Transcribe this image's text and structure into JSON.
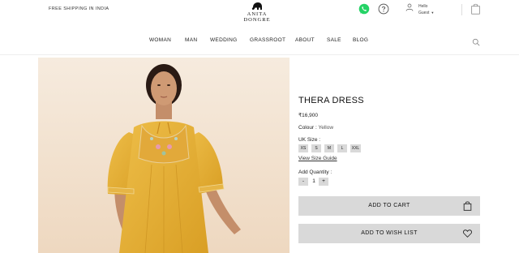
{
  "topbar": {
    "shipping_text": "FREE SHIPPING IN INDIA",
    "brand_name": "ANITA DONGRE",
    "user_greeting": "Hello",
    "user_name": "Guest"
  },
  "icons": {
    "brand_logo": "elephant-logo",
    "whatsapp": "whatsapp-icon",
    "help": "help-icon",
    "user": "user-icon",
    "bag": "shopping-bag-icon",
    "search": "search-icon",
    "wishlist": "heart-icon"
  },
  "nav": {
    "items": [
      {
        "label": "WOMAN"
      },
      {
        "label": "MAN"
      },
      {
        "label": "WEDDING"
      },
      {
        "label": "GRASSROOT"
      },
      {
        "label": "ABOUT"
      },
      {
        "label": "SALE"
      },
      {
        "label": "BLOG"
      }
    ]
  },
  "product": {
    "title": "THERA DRESS",
    "price": "₹16,900",
    "colour_label": "Colour",
    "colour_value": "Yellow",
    "size_label": "UK Size :",
    "sizes": [
      "XS",
      "S",
      "M",
      "L",
      "XXL"
    ],
    "size_guide": "View Size Guide",
    "quantity_label": "Add Quantity :",
    "quantity_minus": "-",
    "quantity_value": "1",
    "quantity_plus": "+",
    "add_to_cart": "ADD TO CART",
    "add_to_wishlist": "ADD TO WISH LIST"
  },
  "colors": {
    "whatsapp_green": "#25d366",
    "button_grey": "#d9d9d9",
    "dress_yellow": "#e8b23a",
    "photo_background": "#f4e6d6"
  }
}
